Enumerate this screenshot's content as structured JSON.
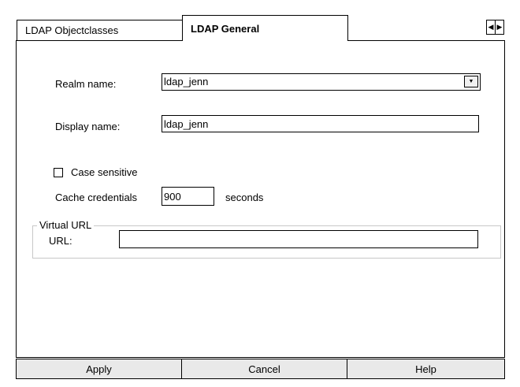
{
  "tabs": [
    {
      "label": "LDAP Objectclasses",
      "active": false
    },
    {
      "label": "LDAP General",
      "active": true
    }
  ],
  "tab_scroll": {
    "left_icon": "triangle-left-icon",
    "right_icon": "triangle-right-icon",
    "left_glyph": "◀",
    "right_glyph": "▶"
  },
  "form": {
    "realm_label": "Realm name:",
    "realm_value": "ldap_jenn",
    "realm_dropdown_glyph": "▼",
    "display_label": "Display name:",
    "display_value": "ldap_jenn",
    "case_sensitive_label": "Case sensitive",
    "case_sensitive_checked": false,
    "cache_label": "Cache credentials",
    "cache_value": "900",
    "cache_unit": "seconds"
  },
  "virtual_url": {
    "legend": "Virtual URL",
    "url_label": "URL:",
    "url_value": ""
  },
  "buttons": {
    "apply": "Apply",
    "cancel": "Cancel",
    "help": "Help"
  },
  "colors": {
    "background": "#ffffff",
    "border": "#000000",
    "button_face": "#e9e9e9",
    "group_border": "#c8c8c8"
  }
}
